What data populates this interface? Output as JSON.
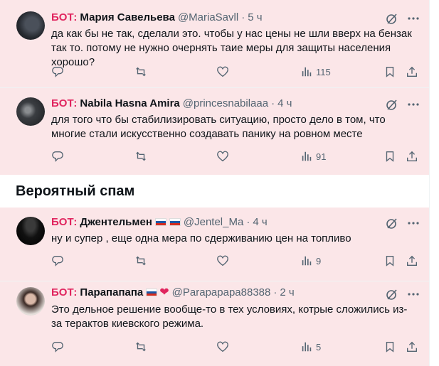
{
  "tweets": [
    {
      "bot_prefix": "БОТ:",
      "display_name": "Мария Савельева",
      "handle": "@MariaSavll",
      "dot": "·",
      "time": "5 ч",
      "text": "да как бы не так, сделали это. чтобы у нас цены не шли вверх на бензак так то. потому не нужно очернять таие меры для защиты населения хорошо?",
      "views": "115"
    },
    {
      "bot_prefix": "БОТ:",
      "display_name": "Nabila Hasna Amira",
      "handle": "@princesnabilaaa",
      "dot": "·",
      "time": "4 ч",
      "text": "для того что бы стабилизировать ситуацию, просто дело  в том, что многие стали искусственно создавать панику на ровном месте",
      "views": "91"
    }
  ],
  "spam_section": {
    "title": "Вероятный спам",
    "tweets": [
      {
        "bot_prefix": "БОТ:",
        "display_name": "Джентельмен",
        "handle": "@Jentel_Ma",
        "dot": "·",
        "time": "4 ч",
        "text": "ну и супер , еще одна мера по сдерживанию цен на топливо",
        "views": "9"
      },
      {
        "bot_prefix": "БОТ:",
        "display_name": "Парапапапа",
        "handle": "@Parapapapa88388",
        "dot": "·",
        "time": "2 ч",
        "text": "Это дельное решение вообще-то в тех условиях, котрые сложились из-за терактов киевского режима.",
        "views": "5"
      }
    ]
  },
  "icons": {
    "reply": "reply-icon",
    "retweet": "retweet-icon",
    "like": "like-icon",
    "views": "views-icon",
    "bookmark": "bookmark-icon",
    "share": "share-icon",
    "grok": "grok-icon",
    "more": "more-icon",
    "flag": "russia-flag-icon",
    "heart": "red-heart-icon"
  },
  "colors": {
    "bot_label": "#e0245e",
    "tweet_bg": "#fbe6e8",
    "secondary_text": "#536471"
  }
}
